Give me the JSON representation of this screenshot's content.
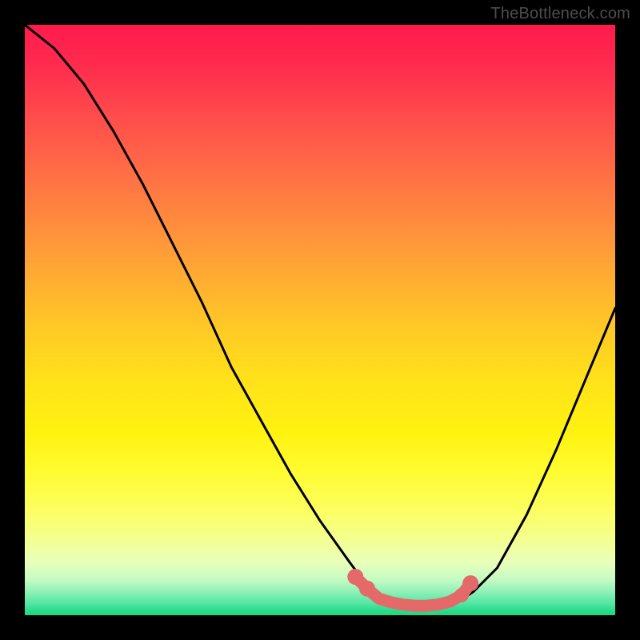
{
  "watermark": "TheBottleneck.com",
  "colors": {
    "bg": "#000000",
    "curve": "#000000",
    "marker": "#e46a6a",
    "marker_stroke": "#e46a6a"
  },
  "chart_data": {
    "type": "line",
    "title": "",
    "xlabel": "",
    "ylabel": "",
    "xlim": [
      0,
      100
    ],
    "ylim": [
      0,
      100
    ],
    "series": [
      {
        "name": "bottleneck-curve",
        "x": [
          0,
          5,
          10,
          15,
          20,
          25,
          30,
          35,
          40,
          45,
          50,
          55,
          58,
          60,
          63,
          66,
          70,
          73,
          76,
          80,
          85,
          90,
          95,
          100
        ],
        "y": [
          100,
          96,
          90,
          82,
          73,
          63,
          53,
          42,
          33,
          24,
          16,
          9,
          5,
          3,
          2,
          1.5,
          1.5,
          2,
          4,
          8,
          17,
          28,
          40,
          52
        ]
      }
    ],
    "markers": {
      "name": "highlighted-points",
      "x": [
        56,
        58,
        60,
        62,
        64,
        66,
        68,
        70,
        72,
        74,
        75.5
      ],
      "y": [
        6.5,
        4.5,
        2.8,
        2.2,
        1.8,
        1.6,
        1.6,
        1.8,
        2.3,
        3.4,
        5.4
      ]
    }
  }
}
